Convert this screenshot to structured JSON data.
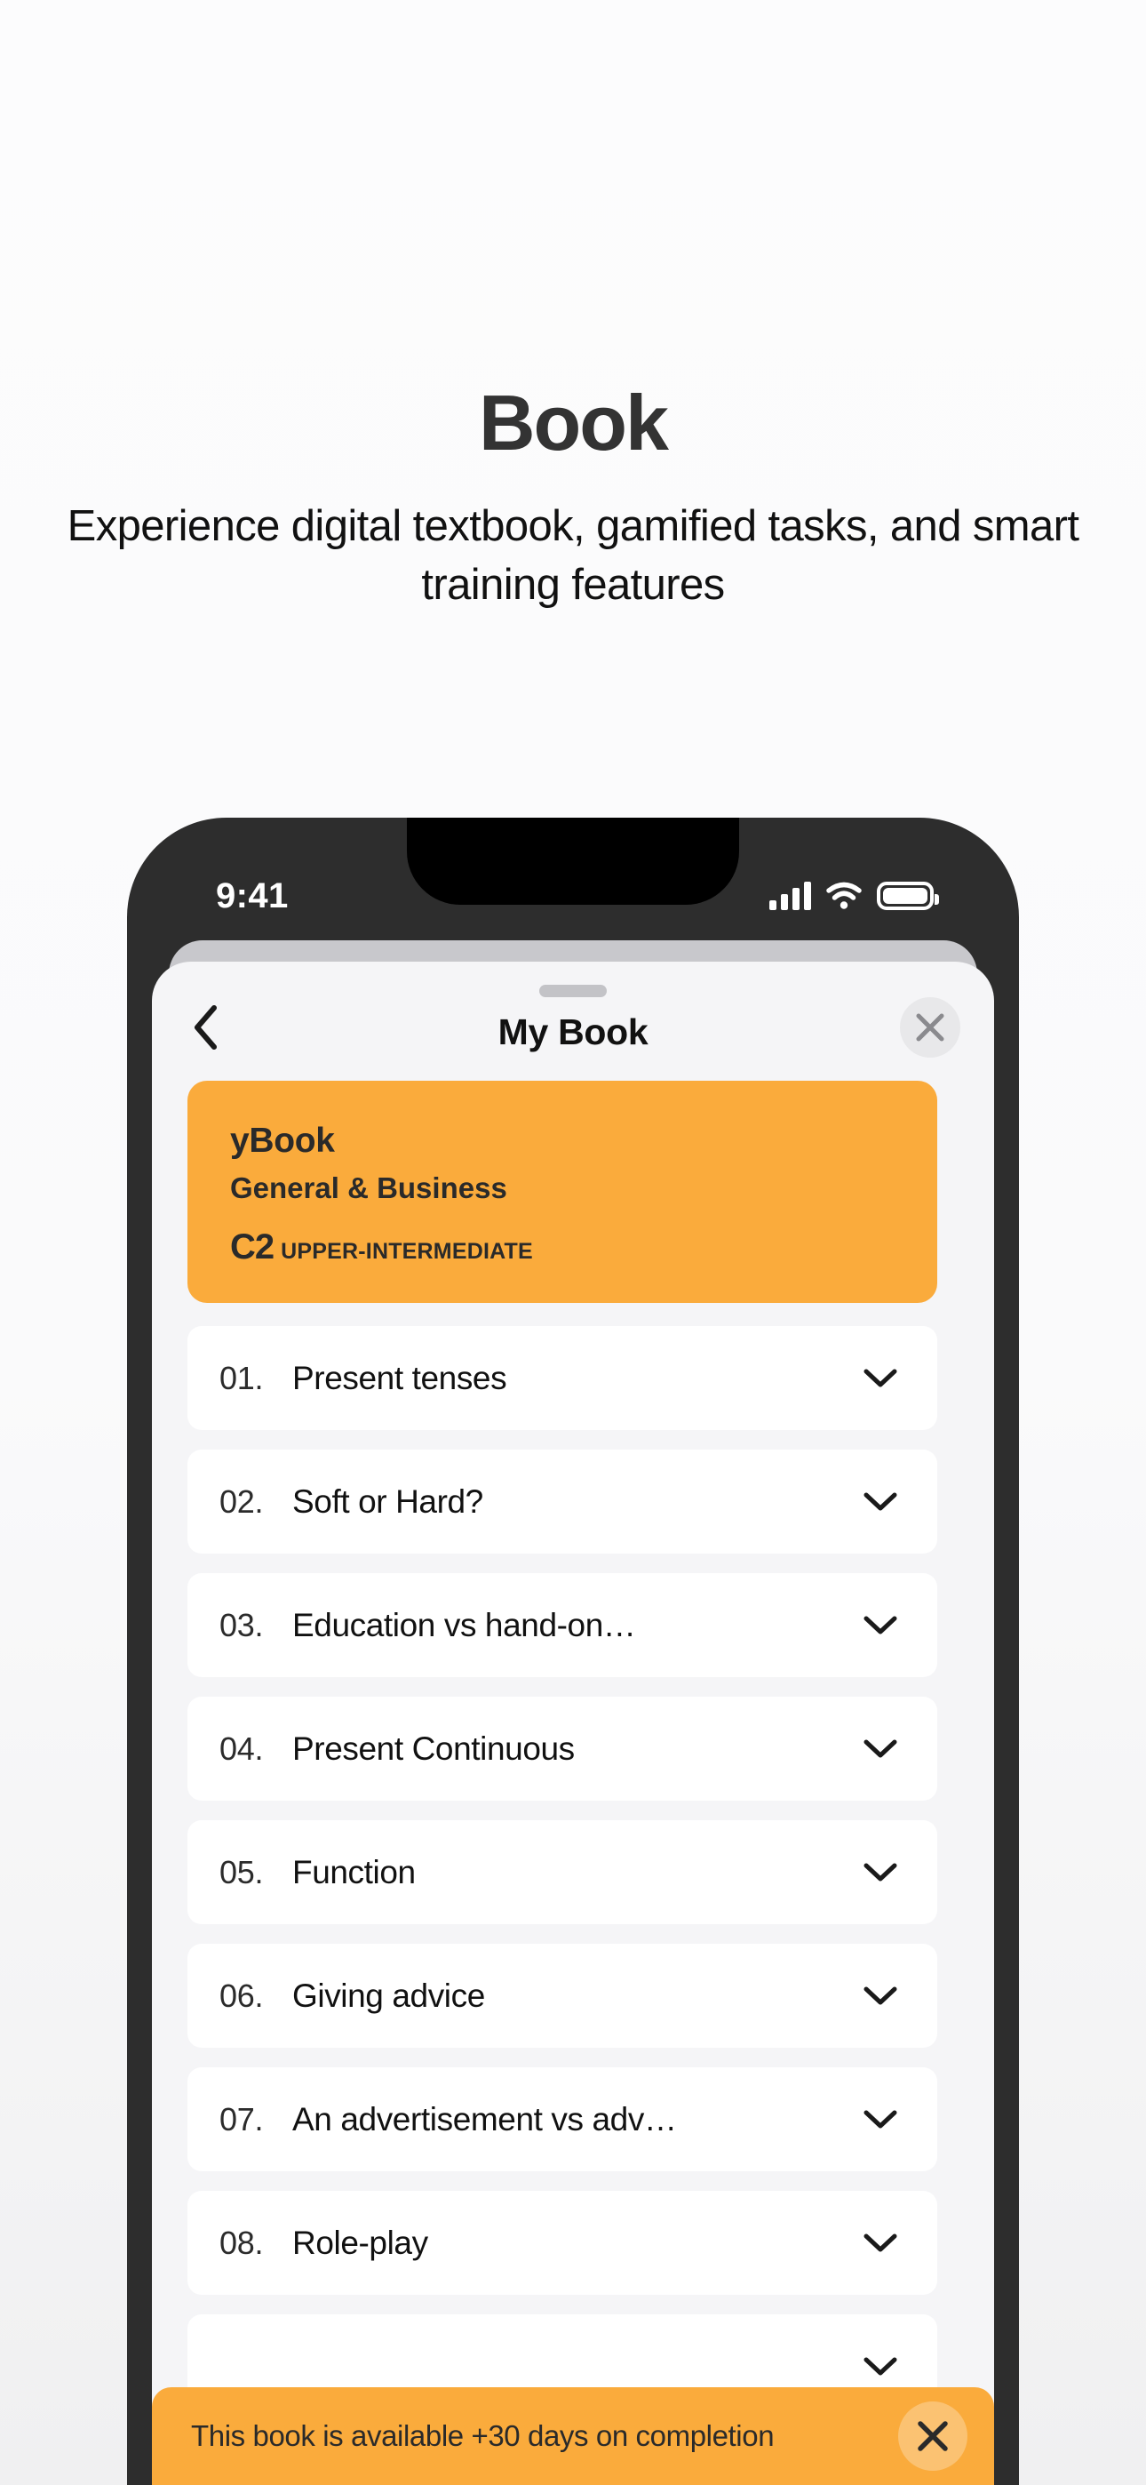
{
  "promo": {
    "title": "Book",
    "subtitle": "Experience digital textbook, gamified tasks, and smart training features"
  },
  "colors": {
    "accent_orange": "#FAAB3C",
    "bezel": "#2D2D2D",
    "sheet_bg": "#F5F5F7",
    "row_bg": "#FFFFFF",
    "text_dark": "#111111"
  },
  "statusbar": {
    "time": "9:41",
    "cellular_icon": "signal-bars-icon",
    "wifi_icon": "wifi-icon",
    "battery_icon": "battery-icon"
  },
  "sheet": {
    "title": "My Book",
    "back_icon": "chevron-left-icon",
    "close_icon": "close-icon",
    "grabber": "drag-handle"
  },
  "book_card": {
    "name": "yBook",
    "category": "General & Business",
    "level_code": "C2",
    "level_name": "UPPER-INTERMEDIATE"
  },
  "units": [
    {
      "number": "01.",
      "title": "Present tenses",
      "expand_icon": "chevron-down-icon"
    },
    {
      "number": "02.",
      "title": "Soft or Hard?",
      "expand_icon": "chevron-down-icon"
    },
    {
      "number": "03.",
      "title": "Education vs hand-on…",
      "expand_icon": "chevron-down-icon"
    },
    {
      "number": "04.",
      "title": "Present Continuous",
      "expand_icon": "chevron-down-icon"
    },
    {
      "number": "05.",
      "title": "Function",
      "expand_icon": "chevron-down-icon"
    },
    {
      "number": "06.",
      "title": "Giving advice",
      "expand_icon": "chevron-down-icon"
    },
    {
      "number": "07.",
      "title": "An advertisement vs adv…",
      "expand_icon": "chevron-down-icon"
    },
    {
      "number": "08.",
      "title": "Role-play",
      "expand_icon": "chevron-down-icon"
    },
    {
      "number": "",
      "title": "",
      "expand_icon": "chevron-down-icon"
    }
  ],
  "toast": {
    "message": "This book is available +30 days on completion",
    "close_icon": "close-icon"
  }
}
